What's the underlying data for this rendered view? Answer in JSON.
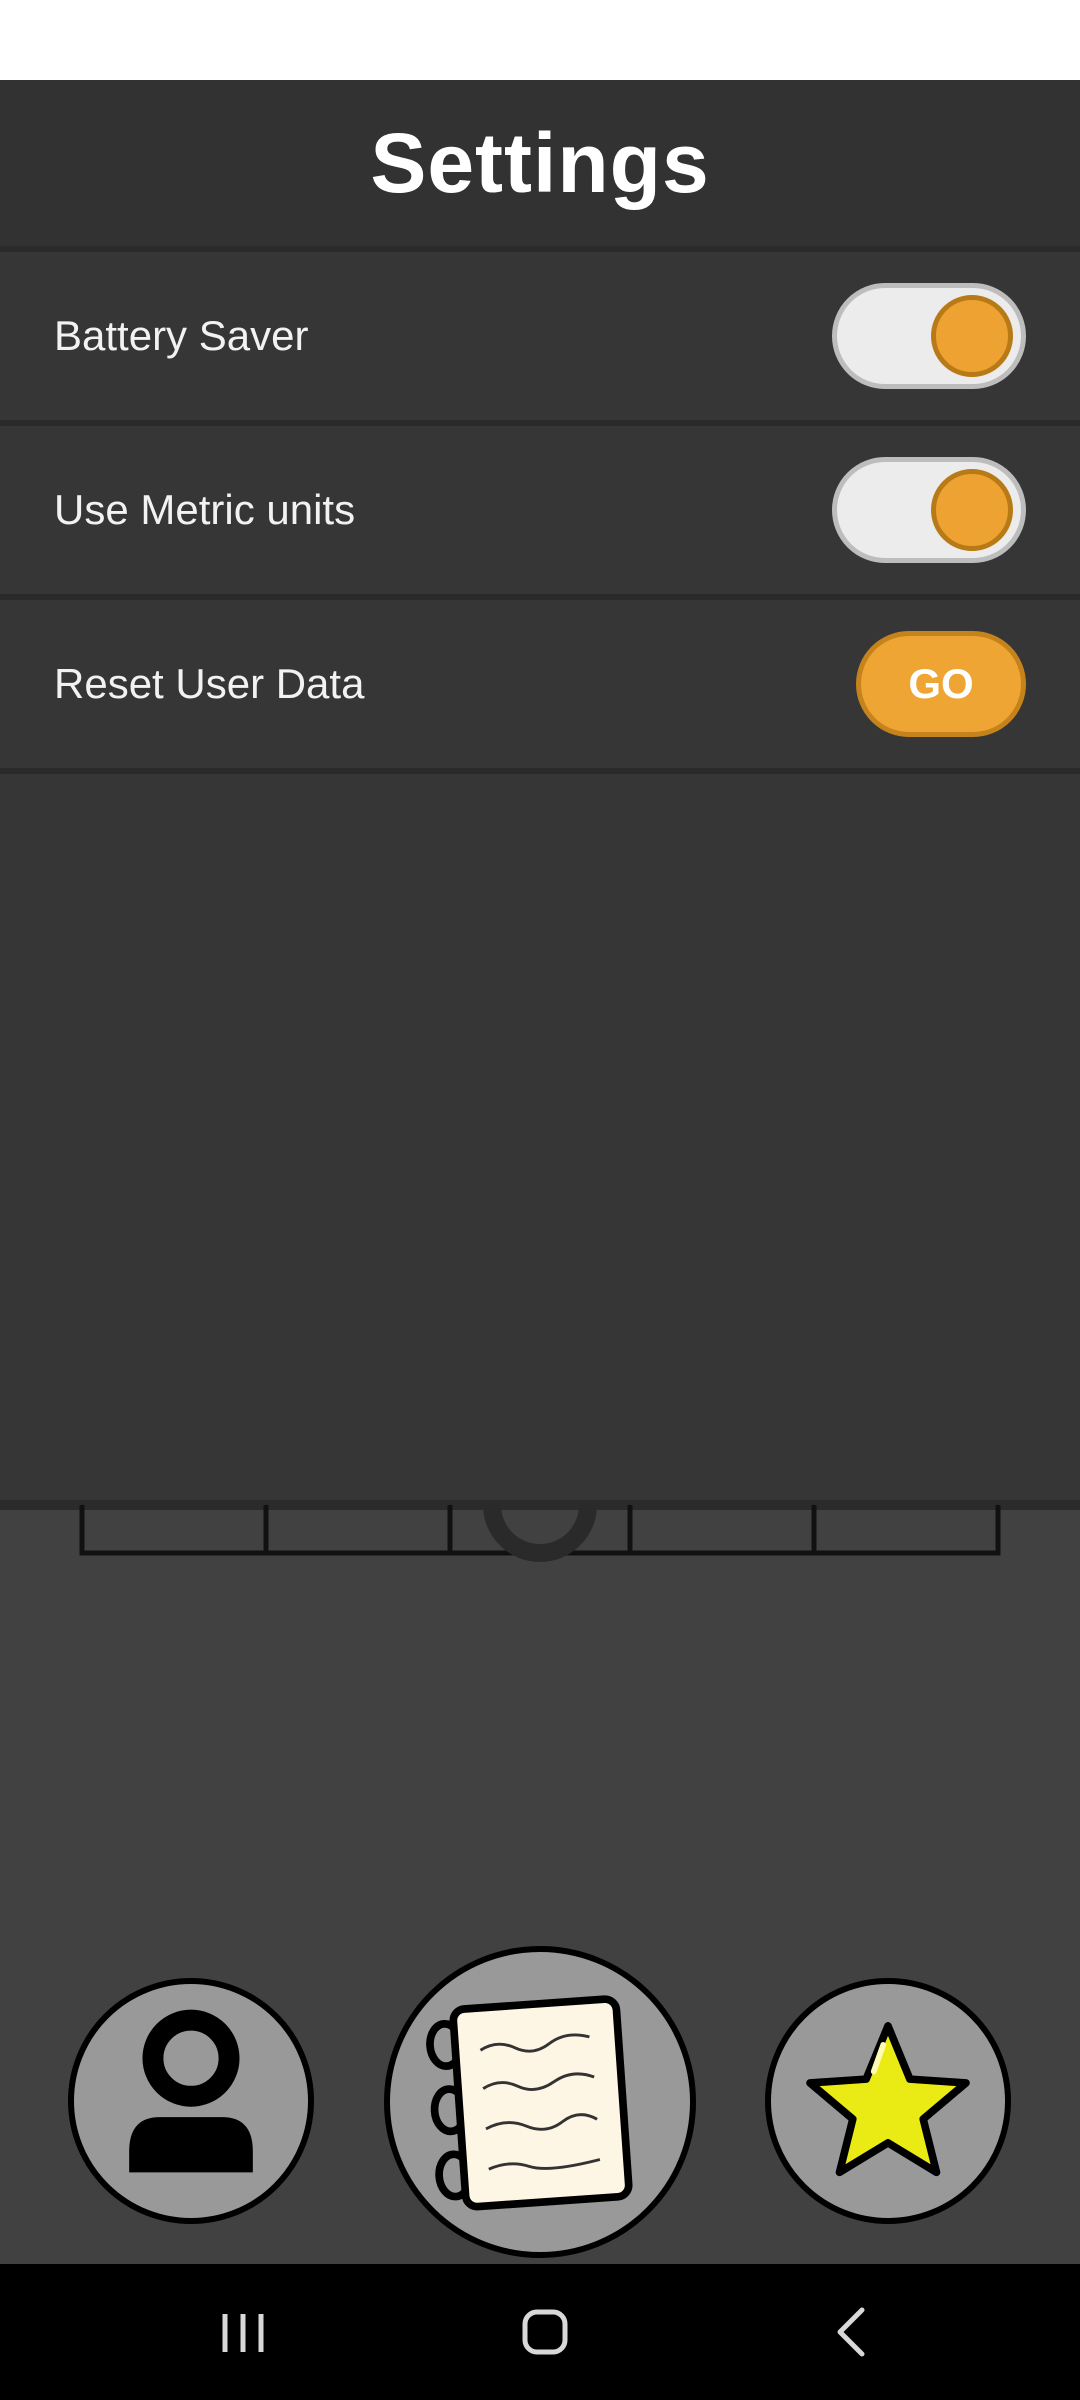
{
  "header": {
    "title": "Settings"
  },
  "settings": [
    {
      "label": "Battery Saver",
      "control": "toggle",
      "state": "on"
    },
    {
      "label": "Use Metric units",
      "control": "toggle",
      "state": "on"
    },
    {
      "label": "Reset User Data",
      "control": "button",
      "button_label": "GO"
    }
  ],
  "bottom_nav": [
    {
      "icon": "profile-icon"
    },
    {
      "icon": "notebook-icon"
    },
    {
      "icon": "star-icon"
    }
  ],
  "system_nav": [
    {
      "icon": "recent-apps-icon"
    },
    {
      "icon": "home-icon"
    },
    {
      "icon": "back-icon"
    }
  ],
  "colors": {
    "accent": "#eda232",
    "panel": "#363636",
    "header": "#323232",
    "background": "#414141",
    "nav_circle": "#999999",
    "star": "#eaea14"
  }
}
